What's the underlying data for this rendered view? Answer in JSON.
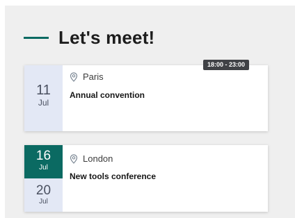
{
  "section": {
    "title": "Let's meet!"
  },
  "events": [
    {
      "time": "18:00 - 23:00",
      "location": "Paris",
      "title": "Annual convention",
      "date": {
        "day": "11",
        "month": "Jul"
      }
    },
    {
      "location": "London",
      "title": "New tools conference",
      "start": {
        "day": "16",
        "month": "Jul"
      },
      "end": {
        "day": "20",
        "month": "Jul"
      }
    }
  ],
  "colors": {
    "accent": "#0b6a62",
    "date_background": "#e3e8f5",
    "badge": "#404246",
    "panel_background": "#efefef"
  },
  "icons": {
    "location": "map-pin-icon"
  }
}
